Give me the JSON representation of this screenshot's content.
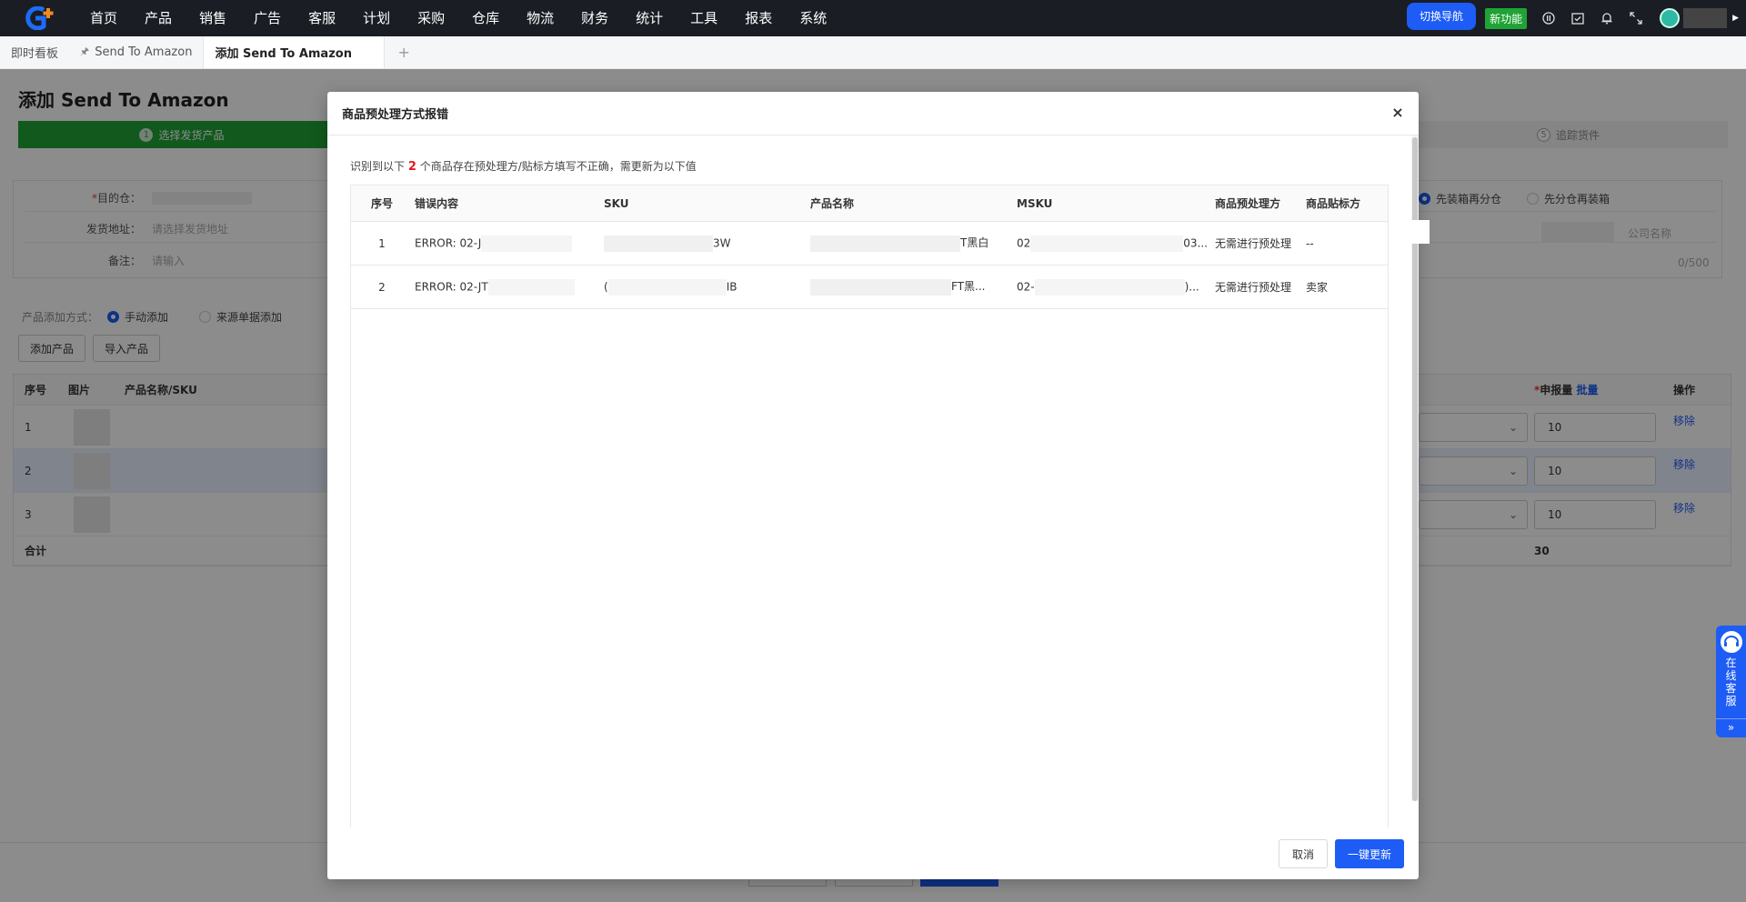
{
  "nav": {
    "items": [
      "首页",
      "产品",
      "销售",
      "广告",
      "客服",
      "计划",
      "采购",
      "仓库",
      "物流",
      "财务",
      "统计",
      "工具",
      "报表",
      "系统"
    ],
    "switch_nav": "切换导航",
    "new_feature": "新功能"
  },
  "tabs": {
    "items": [
      {
        "label": "即时看板"
      },
      {
        "label": "Send To Amazon"
      },
      {
        "label": "添加 Send To Amazon"
      }
    ],
    "add": "+"
  },
  "page": {
    "title": "添加 Send To Amazon",
    "step1": "选择发货产品",
    "step1_num": "1",
    "step_last": "追踪货件",
    "step_last_num": "5",
    "form": {
      "dest_label": "目的仓：",
      "address_label": "发货地址：",
      "address_placeholder": "请选择发货地址",
      "remark_label": "备注：",
      "remark_placeholder": "请输入",
      "opt_pack_first": "先装箱再分仓",
      "opt_split_first": "先分仓再装箱",
      "company": "公司名称",
      "counter": "0/500"
    },
    "add_mode_label": "产品添加方式：",
    "add_mode_manual": "手动添加",
    "add_mode_source": "来源单据添加",
    "btn_add": "添加产品",
    "btn_import": "导入产品",
    "table": {
      "headers": {
        "idx": "序号",
        "img": "图片",
        "name": "产品名称/SKU",
        "qty": "申报量",
        "batch": "批量",
        "ops": "操作"
      },
      "rows": [
        {
          "idx": "1",
          "qty": "10",
          "remove": "移除"
        },
        {
          "idx": "2",
          "qty": "10",
          "remove": "移除"
        },
        {
          "idx": "3",
          "qty": "10",
          "remove": "移除"
        }
      ],
      "total_label": "合计",
      "total_qty": "30"
    }
  },
  "chat": {
    "label": "在线客服",
    "more": "»"
  },
  "modal": {
    "title": "商品预处理方式报错",
    "notice_pre": "识别到以下",
    "notice_num": "2",
    "notice_post": "个商品存在预处理方/贴标方填写不正确，需更新为以下值",
    "headers": {
      "idx": "序号",
      "err": "错误内容",
      "sku": "SKU",
      "name": "产品名称",
      "msku": "MSKU",
      "prep": "商品预处理方",
      "label": "商品贴标方"
    },
    "rows": [
      {
        "idx": "1",
        "err": "ERROR: 02-J",
        "sku_tail": "3W",
        "name_tail": "T黑白",
        "msku_head": "02",
        "msku_tail": "03...",
        "prep": "无需进行预处理",
        "label": "--"
      },
      {
        "idx": "2",
        "err": "ERROR: 02-JT",
        "sku_head": "(",
        "sku_tail": "IB",
        "name_tail": "FT黑...",
        "msku_head": "02-",
        "msku_tail": ")...",
        "prep": "无需进行预处理",
        "label": "卖家"
      }
    ],
    "cancel": "取消",
    "confirm": "一键更新"
  }
}
